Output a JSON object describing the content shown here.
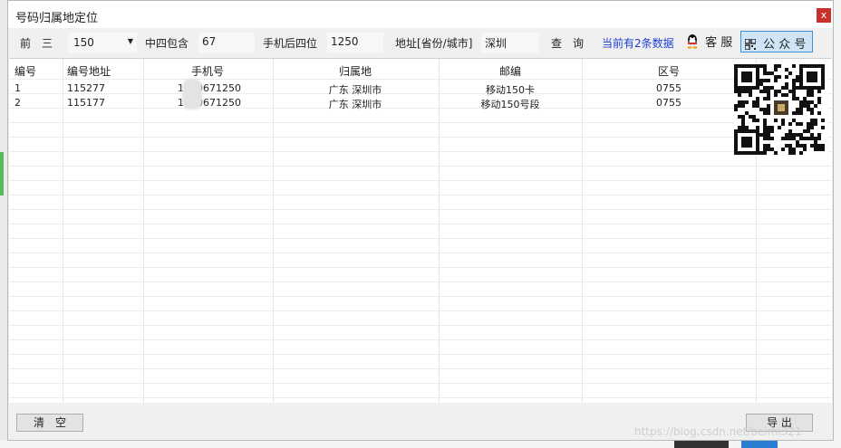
{
  "window": {
    "title": "号码归属地定位",
    "close_label": "x"
  },
  "toolbar": {
    "prefix_label": "前　三",
    "prefix_value": "150",
    "middle_label": "中四包含",
    "middle_value": "67",
    "tail_label": "手机后四位",
    "tail_value": "1250",
    "address_label": "地址[省份/城市]",
    "address_value": "深圳",
    "query_label": "查　询",
    "status": "当前有2条数据",
    "service_label": "客 服",
    "gzh_label": "公 众 号"
  },
  "table": {
    "columns": [
      "编号",
      "编号地址",
      "手机号",
      "归属地",
      "邮编",
      "区号"
    ],
    "rows": [
      {
        "id": "1",
        "code": "115277",
        "phone": "1500671250",
        "location": "广东  深圳市",
        "postcode": "移动150卡",
        "area": "0755"
      },
      {
        "id": "2",
        "code": "115177",
        "phone": "1500671250",
        "location": "广东  深圳市",
        "postcode": "移动150号段",
        "area": "0755"
      }
    ]
  },
  "bottom": {
    "clear_label": "清　空",
    "export_label": "导 出"
  },
  "watermark": "https://blog.csdn.net/beimi321",
  "colors": {
    "status": "#1a3fd6",
    "close": "#c9302c",
    "gzh_bg": "#cfe5f7"
  }
}
